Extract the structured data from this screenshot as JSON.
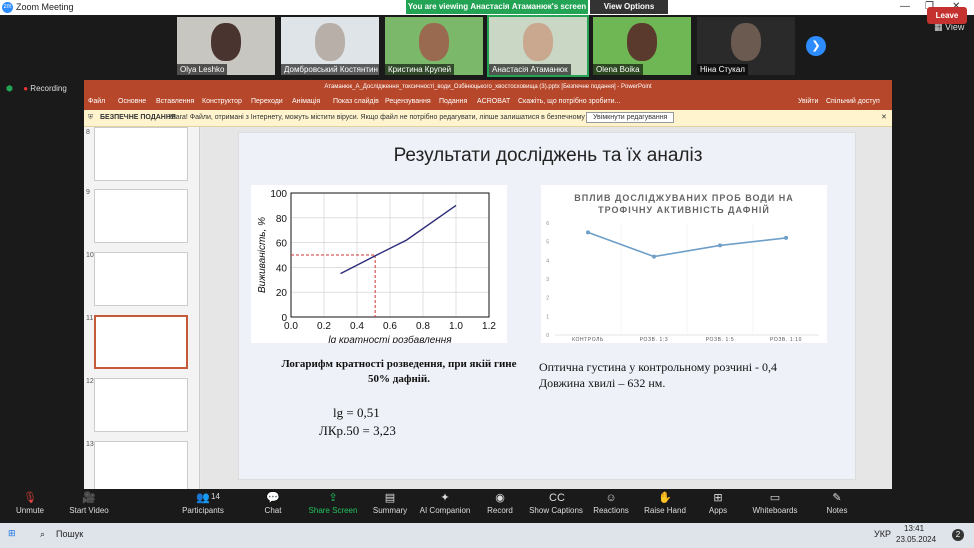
{
  "window": {
    "title": "Zoom Meeting",
    "banner": "You are viewing Анастасія Атаманюк's screen",
    "view_options": "View Options"
  },
  "participants": [
    {
      "name": "Olya Leshko"
    },
    {
      "name": "Домбровський Костянтин"
    },
    {
      "name": "Кристина Крупей"
    },
    {
      "name": "Анастасія Атаманюк"
    },
    {
      "name": "Olena Boika"
    },
    {
      "name": "Ніна Стукал"
    }
  ],
  "view_label": "View",
  "recording_label": "Recording",
  "powerpoint": {
    "title": "Атаманюк_А_Дослідження_токсичності_води_Озбінюцького_хвостосховища (3).pptx [Безпечне подання] - PowerPoint",
    "tabs": [
      "Файл",
      "Основне",
      "Вставлення",
      "Конструктор",
      "Переходи",
      "Анімація",
      "Показ слайдів",
      "Рецензування",
      "Подання",
      "ACROBAT",
      "Скажіть, що потрібно зробити..."
    ],
    "signin": "Увійти",
    "share": "Спільний доступ",
    "protected_label": "БЕЗПЕЧНЕ ПОДАННЯ",
    "protected_msg": "Увага! Файли, отримані з Інтернету, можуть містити віруси. Якщо файл не потрібно редагувати, ліпше залишатися в безпечному поданні.",
    "enable_edit": "Увімкнути редагування",
    "thumb_numbers": [
      "8",
      "9",
      "10",
      "11",
      "12",
      "13"
    ]
  },
  "slide": {
    "title": "Результати досліджень та їх аналіз",
    "left_caption": "Логарифм кратності розведення, при якій гине 50% дафній.",
    "formula1": "lg = 0,51",
    "formula2": "ЛКр.50 = 3,23",
    "right_caption1": "Оптична густина у контрольному розчині  - 0,4",
    "right_caption2": "Довжина хвилі – 632 нм."
  },
  "chart_data": [
    {
      "type": "line",
      "xlabel": "lg кратності розбавлення",
      "ylabel": "Виживаність, %",
      "xlim": [
        0,
        1.2
      ],
      "ylim": [
        0,
        100
      ],
      "xticks": [
        "0.0",
        "0.2",
        "0.4",
        "0.6",
        "0.8",
        "1.0",
        "1.2"
      ],
      "yticks": [
        "0",
        "20",
        "40",
        "60",
        "80",
        "100"
      ],
      "grid": true,
      "series": [
        {
          "x": [
            0.3,
            0.52,
            0.7,
            1.0
          ],
          "y": [
            35,
            50,
            62,
            90
          ]
        }
      ],
      "annotation": {
        "x": 0.51,
        "y": 50
      }
    },
    {
      "type": "line",
      "title": "ВПЛИВ ДОСЛІДЖУВАНИХ ПРОБ ВОДИ НА ТРОФІЧНУ АКТИВНІСТЬ ДАФНІЙ",
      "categories": [
        "КОНТРОЛЬ",
        "РОЗВ. 1:3",
        "РОЗВ. 1:5",
        "РОЗВ. 1:10"
      ],
      "ylim": [
        0,
        6
      ],
      "yticks": [
        "0",
        "1",
        "2",
        "3",
        "4",
        "5",
        "6"
      ],
      "series": [
        {
          "values": [
            5.5,
            4.2,
            4.8,
            5.2
          ]
        }
      ],
      "color": "#6f9fc8"
    }
  ],
  "toolbar": [
    {
      "label": "Unmute",
      "icon": "mic-off-icon"
    },
    {
      "label": "Start Video",
      "icon": "video-off-icon"
    },
    {
      "label": "Participants",
      "icon": "participants-icon",
      "count": "14"
    },
    {
      "label": "Chat",
      "icon": "chat-icon"
    },
    {
      "label": "Share Screen",
      "icon": "share-screen-icon"
    },
    {
      "label": "Summary",
      "icon": "summary-icon"
    },
    {
      "label": "AI Companion",
      "icon": "ai-companion-icon"
    },
    {
      "label": "Record",
      "icon": "record-icon"
    },
    {
      "label": "Show Captions",
      "icon": "captions-icon"
    },
    {
      "label": "Reactions",
      "icon": "reactions-icon"
    },
    {
      "label": "Raise Hand",
      "icon": "raise-hand-icon"
    },
    {
      "label": "Apps",
      "icon": "apps-icon"
    },
    {
      "label": "Whiteboards",
      "icon": "whiteboard-icon"
    },
    {
      "label": "Notes",
      "icon": "notes-icon"
    }
  ],
  "leave": "Leave",
  "taskbar": {
    "search": "Пошук",
    "lang": "УКР",
    "time": "13:41",
    "date": "23.05.2024",
    "badge": "2"
  }
}
